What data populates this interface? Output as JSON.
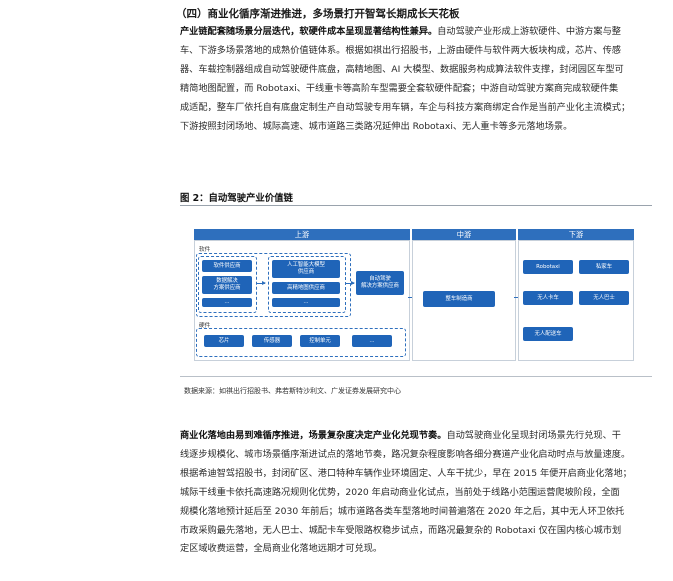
{
  "section_title": "（四）商业化循序渐进推进，多场景打开智驾长期成长天花板",
  "para1": {
    "lead": "产业链配套随场景分层迭代，软硬件成本呈现显著结构性兼异。",
    "lines": [
      "自动驾驶产业形成上游软硬件、中游方案与整",
      "车、下游多场景落地的成熟价值链体系。根据如祺出行招股书，上游由硬件与软件两大板块构成，芯片、传感",
      "器、车载控制器组成自动驾驶硬件底盘，高精地图、AI 大模型、数据服务构成算法软件支撑，封闭园区车型可",
      "精简地图配置，而 Robotaxi、干线重卡等高阶车型需要全套软硬件配套；中游自动驾驶方案商完成软硬件集",
      "成适配，整车厂依托自有底盘定制生产自动驾驶专用车辆，车企与科技方案商绑定合作是当前产业化主流模式；",
      "下游按照封闭场地、城际高速、城市道路三类路况延伸出 Robotaxi、无人重卡等多元落地场景。"
    ]
  },
  "figure": {
    "title": "图 2：自动驾驶产业价值链",
    "upstream": {
      "head": "上游",
      "software_label": "软件",
      "software_col1": [
        "软件供应商",
        "数据解决\n方案供应商",
        "..."
      ],
      "software_col2": [
        "人工智能大模型\n供应商",
        "高精地图供应商",
        "..."
      ],
      "integrator": "自动驾驶\n解决方案供应商",
      "hardware_label": "硬件",
      "hardware": [
        "芯片",
        "传感器",
        "控制单元",
        "..."
      ]
    },
    "midstream": {
      "head": "中游",
      "item": "整车制造商"
    },
    "downstream": {
      "head": "下游",
      "items": [
        "Robotaxi",
        "私家车",
        "无人卡车",
        "无人巴士",
        "无人配送车"
      ]
    }
  },
  "source": "数据来源：如祺出行招股书、弗若斯特沙利文、广发证券发展研究中心",
  "para2": {
    "lead": "商业化落地由易到难循序推进，场景复杂度决定产业化兑现节奏。",
    "lines": [
      "自动驾驶商业化呈现封闭场景先行兑现、干",
      "线逐步规模化、城市场景循序渐进试点的落地节奏，路况复杂程度影响各细分赛道产业化启动时点与放量速度。",
      "根据希迪智驾招股书，封闭矿区、港口特种车辆作业环境固定、人车干扰少，早在 2015 年便开启商业化落地；",
      "城际干线重卡依托高速路况规则化优势，2020 年启动商业化试点，当前处于线路小范围运营爬坡阶段，全面",
      "规模化落地预计延后至 2030 年前后；城市道路各类车型落地时间普遍落在 2020 年之后，其中无人环卫依托",
      "市政采购最先落地，无人巴士、城配卡车受限路权稳步试点，而路况最复杂的 Robotaxi 仅在国内核心城市划",
      "定区域收费运营，全局商业化落地远期才可兑现。"
    ]
  }
}
